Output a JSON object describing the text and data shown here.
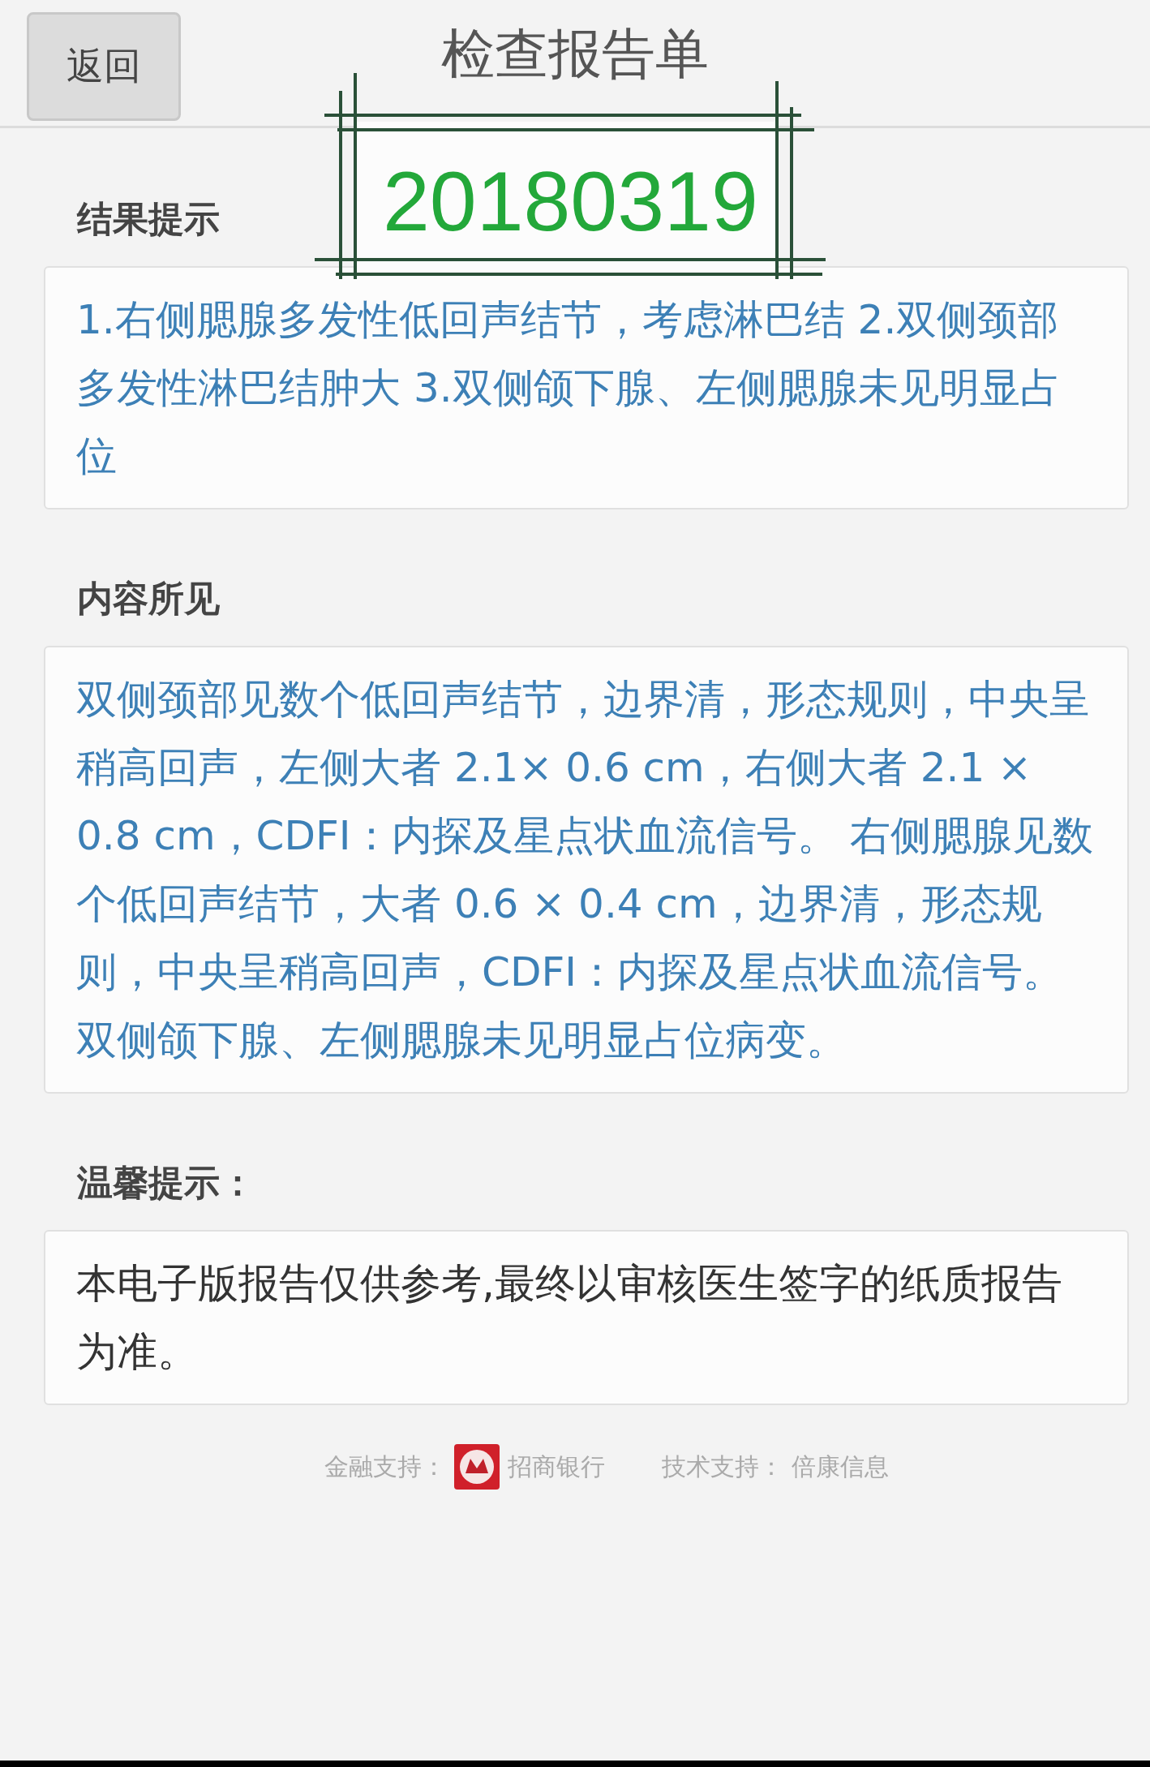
{
  "header": {
    "back_button": "返回",
    "title": "检查报告单"
  },
  "stamp": {
    "text": "20180319"
  },
  "sections": [
    {
      "heading": "结果提示",
      "kind": "result",
      "text": "1.右侧腮腺多发性低回声结节，考虑淋巴结 2.双侧颈部多发性淋巴结肿大 3.双侧颌下腺、左侧腮腺未见明显占位"
    },
    {
      "heading": "内容所见",
      "kind": "result",
      "text": "双侧颈部见数个低回声结节，边界清，形态规则，中央呈稍高回声，左侧大者 2.1× 0.6 cm，右侧大者 2.1 × 0.8 cm，CDFI：内探及星点状血流信号。 右侧腮腺见数个低回声结节，大者 0.6 × 0.4 cm，边界清，形态规则，中央呈稍高回声，CDFI：内探及星点状血流信号。双侧颌下腺、左侧腮腺未见明显占位病变。"
    },
    {
      "heading": "温馨提示：",
      "kind": "notice",
      "text": "本电子版报告仅供参考,最终以审核医生签字的纸质报告为准。"
    }
  ],
  "footer": {
    "finance_label": "金融支持：",
    "bank": "招商银行",
    "tech_label": "技术支持：",
    "tech": "倍康信息"
  }
}
